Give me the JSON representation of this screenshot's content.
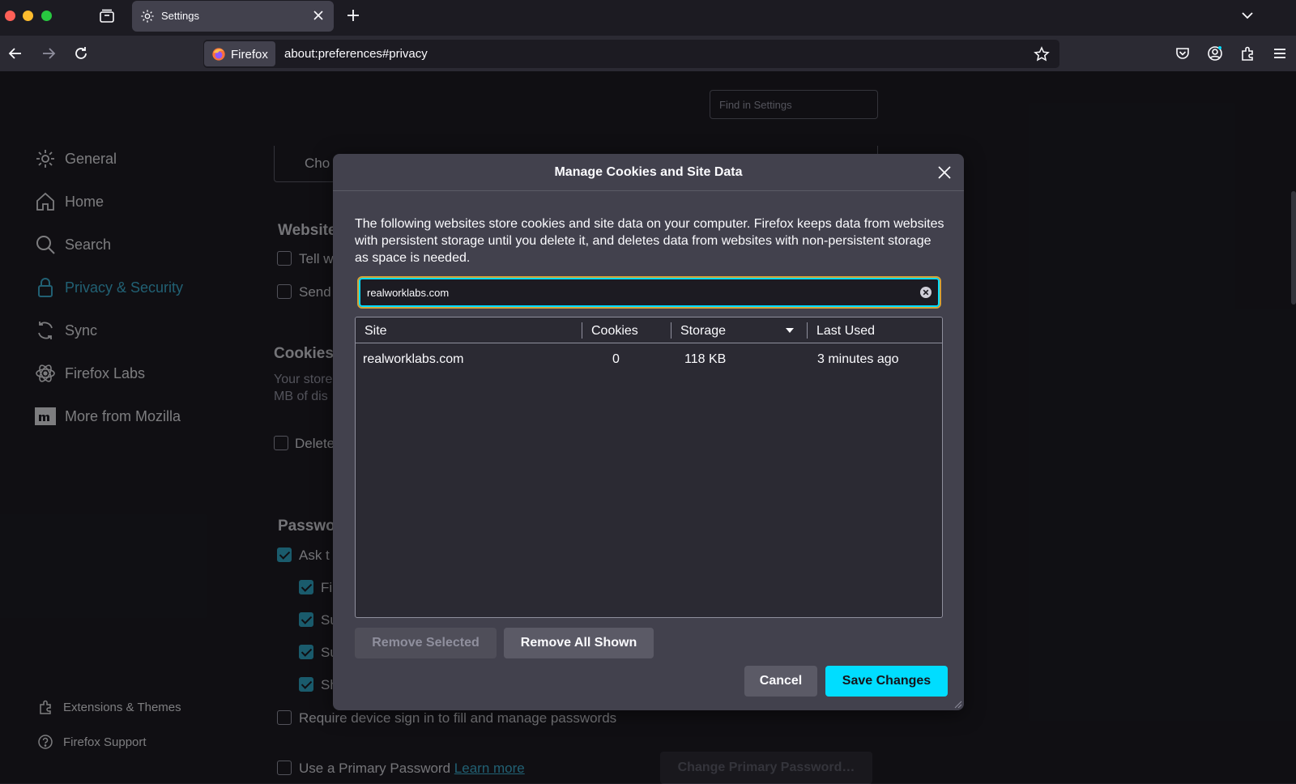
{
  "browser": {
    "tab_title": "Settings",
    "identity_label": "Firefox",
    "url": "about:preferences#privacy"
  },
  "settings": {
    "find_placeholder": "Find in Settings",
    "sidebar": [
      {
        "label": "General",
        "icon": "gear-icon"
      },
      {
        "label": "Home",
        "icon": "home-icon"
      },
      {
        "label": "Search",
        "icon": "search-icon"
      },
      {
        "label": "Privacy & Security",
        "icon": "lock-icon",
        "active": true
      },
      {
        "label": "Sync",
        "icon": "sync-icon"
      },
      {
        "label": "Firefox Labs",
        "icon": "atom-icon"
      },
      {
        "label": "More from Mozilla",
        "icon": "mozilla-icon"
      }
    ],
    "sidebar_footer": [
      {
        "label": "Extensions & Themes",
        "icon": "puzzle-icon"
      },
      {
        "label": "Firefox Support",
        "icon": "help-icon"
      }
    ],
    "background": {
      "choose_text": "Cho",
      "websites_heading": "Website",
      "tell_text": "Tell w",
      "send_text": "Send",
      "cookies_heading": "Cookies",
      "cookies_desc_1": "Your store",
      "cookies_desc_2": "MB of dis",
      "delete_text": "Delete",
      "passwords_heading": "Passwo",
      "ask_text": "Ask t",
      "fill_text": "Fi",
      "suggest1_text": "Su",
      "suggest2_text": "Su",
      "show_text": "Sh",
      "require_sign_in": "Require device sign in to fill and manage passwords",
      "primary_password": "Use a Primary Password",
      "learn_more": "Learn more",
      "change_primary_password": "Change Primary Password…"
    }
  },
  "dialog": {
    "title": "Manage Cookies and Site Data",
    "description": "The following websites store cookies and site data on your computer. Firefox keeps data from websites with persistent storage until you delete it, and deletes data from websites with non-persistent storage as space is needed.",
    "search_value": "realworklabs.com",
    "columns": {
      "site": "Site",
      "cookies": "Cookies",
      "storage": "Storage",
      "last_used": "Last Used"
    },
    "rows": [
      {
        "site": "realworklabs.com",
        "cookies": "0",
        "storage": "118 KB",
        "last_used": "3 minutes ago"
      }
    ],
    "buttons": {
      "remove_selected": "Remove Selected",
      "remove_all_shown": "Remove All Shown",
      "cancel": "Cancel",
      "save_changes": "Save Changes"
    }
  },
  "colors": {
    "accent": "#00ddff",
    "active_nav": "#3aa6c6",
    "dialog_bg": "#42414d"
  }
}
